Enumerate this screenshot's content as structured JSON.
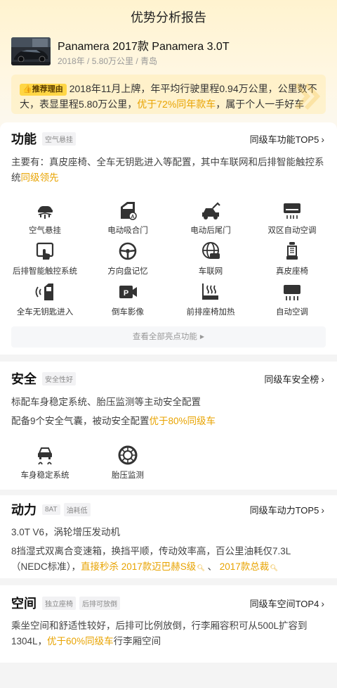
{
  "page_title": "优势分析报告",
  "car": {
    "name": "Panamera 2017款 Panamera 3.0T",
    "meta": "2018年 / 5.80万公里 / 青岛",
    "thumb_icon": "car-photo"
  },
  "recommend": {
    "badge": "推荐理由",
    "text_1": "2018年11月上牌，年平均行驶里程0.94万公里，公里数不大，表显里程5.80万公里，",
    "highlight": "优于72%同年款车",
    "text_2": "，属于个人一手好车",
    "highlight_color": "#e8a300"
  },
  "function_section": {
    "title": "功能",
    "tag": "空气悬挂",
    "link": "同级车功能TOP5",
    "desc_text": "主要有：真皮座椅、全车无钥匙进入等配置，其中车联网和后排智能触控系统",
    "desc_highlight": "同级领先",
    "features": [
      {
        "label": "空气悬挂",
        "icon": "air-suspension-icon"
      },
      {
        "label": "电动吸合门",
        "icon": "soft-close-door-icon"
      },
      {
        "label": "电动后尾门",
        "icon": "power-tailgate-icon"
      },
      {
        "label": "双区自动空调",
        "icon": "dual-zone-ac-icon"
      },
      {
        "label": "后排智能触控系统",
        "icon": "rear-touch-control-icon"
      },
      {
        "label": "方向盘记忆",
        "icon": "steering-memory-icon"
      },
      {
        "label": "车联网",
        "icon": "connected-car-icon"
      },
      {
        "label": "真皮座椅",
        "icon": "leather-seat-icon"
      },
      {
        "label": "全车无钥匙进入",
        "icon": "keyless-entry-icon"
      },
      {
        "label": "倒车影像",
        "icon": "reverse-camera-icon"
      },
      {
        "label": "前排座椅加热",
        "icon": "seat-heating-icon"
      },
      {
        "label": "自动空调",
        "icon": "auto-ac-icon"
      }
    ],
    "view_all": "查看全部亮点功能"
  },
  "safety_section": {
    "title": "安全",
    "tag": "安全性好",
    "link": "同级车安全榜",
    "line1": "标配车身稳定系统、胎压监测等主动安全配置",
    "line2_text": "配备9个安全气囊，被动安全配置",
    "line2_highlight": "优于80%同级车",
    "features": [
      {
        "label": "车身稳定系统",
        "icon": "stability-control-icon"
      },
      {
        "label": "胎压监测",
        "icon": "tire-pressure-icon"
      }
    ]
  },
  "power_section": {
    "title": "动力",
    "tags": [
      "8AT",
      "油耗低"
    ],
    "link": "同级车动力TOP5",
    "line1": "3.0T V6，涡轮增压发动机",
    "line2_text": "8挡湿式双离合变速箱，换挡平顺，传动效率高，百公里油耗仅7.3L（NEDC标准），",
    "line2_highlight": "直接秒杀 2017款迈巴赫S级",
    "sep": " 、 ",
    "line2_highlight2": "2017款总裁"
  },
  "space_section": {
    "title": "空间",
    "tags": [
      "独立座椅",
      "后排可放倒"
    ],
    "link": "同级车空间TOP4",
    "text_1": "乘坐空间和舒适性较好，后排可比例放倒，行李厢容积可从500L扩容到1304L，",
    "highlight": "优于60%同级车",
    "text_2": "行李厢空间"
  }
}
